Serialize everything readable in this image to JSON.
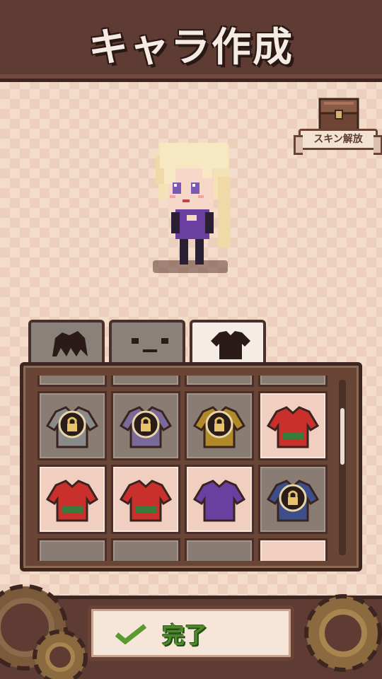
{
  "header": {
    "title": "キャラ作成"
  },
  "skin_unlock": {
    "label": "スキン解放",
    "icon": "treasure-chest-icon"
  },
  "tabs": [
    {
      "icon": "hair-icon",
      "active": false
    },
    {
      "icon": "face-icon",
      "active": false
    },
    {
      "icon": "outfit-icon",
      "active": true
    }
  ],
  "outfits": [
    {
      "color": "#8a8a8a",
      "locked": true
    },
    {
      "color": "#7a6a9a",
      "locked": true
    },
    {
      "color": "#b08a2a",
      "locked": true
    },
    {
      "color": "#c9302c",
      "locked": false
    },
    {
      "color": "#c9302c",
      "locked": false
    },
    {
      "color": "#c9302c",
      "locked": false
    },
    {
      "color": "#6b3fa0",
      "locked": false
    },
    {
      "color": "#3d4f8a",
      "locked": true
    }
  ],
  "footer": {
    "done_label": "完了",
    "done_icon": "check-icon"
  },
  "colors": {
    "frame": "#5e3b33",
    "panel": "#694536",
    "accent_green": "#4f8a2a"
  }
}
